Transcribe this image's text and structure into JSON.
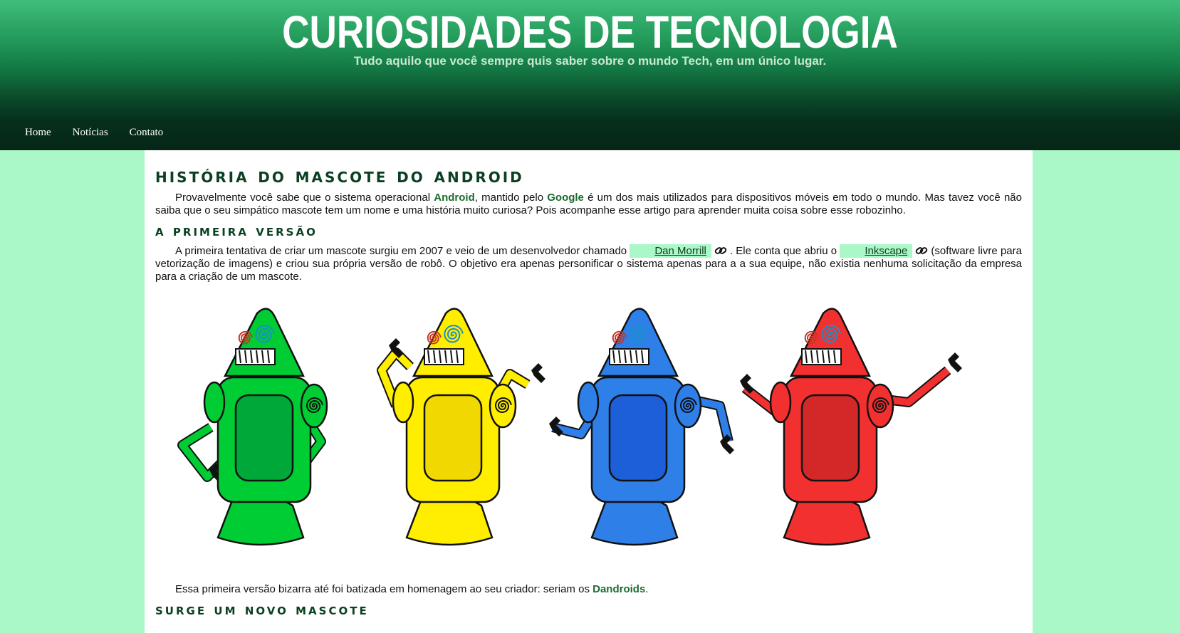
{
  "header": {
    "title": "CURIOSIDADES DE TECNOLOGIA",
    "subtitle": "Tudo aquilo que você sempre quis saber sobre o mundo Tech, em um único lugar."
  },
  "nav": [
    {
      "label": "Home"
    },
    {
      "label": "Notícias"
    },
    {
      "label": "Contato"
    }
  ],
  "article": {
    "title": "História do mascote do Android",
    "intro": {
      "t1": "Provavelmente você sabe que o sistema operacional ",
      "kw1": "Android",
      "t2": ", mantido pelo ",
      "kw2": "Google",
      "t3": " é um dos mais utilizados para dispositivos móveis em todo o mundo. Mas tavez você não saiba que o seu simpático mascote tem um nome e uma história muito curiosa? Pois acompanhe esse artigo para aprender muita coisa sobre esse robozinho."
    },
    "section1": {
      "title": "A primeira versão",
      "p1": {
        "t1": "A primeira tentativa de criar um mascote surgiu em 2007 e veio de um desenvolvedor chamado ",
        "link1": "Dan Morrill",
        "t2": ". Ele conta que abriu o ",
        "link2": "Inkscape",
        "t3": "(software livre para vetorização de imagens) e criou sua própria versão de robô. O objetivo era apenas personificar o sistema apenas para a a sua equipe, não existia nenhuma solicitação da empresa para a criação de um mascote."
      },
      "p2": {
        "t1": "Essa primeira versão bizarra até foi batizada em homenagem ao seu criador: seriam os ",
        "kw": "Dandroids",
        "t2": "."
      }
    },
    "section2": {
      "title": "Surge um novo mascote"
    }
  },
  "robots": {
    "items": [
      {
        "name": "green-robot",
        "color": "#00cc33",
        "dark": "#00a83a"
      },
      {
        "name": "yellow-robot",
        "color": "#ffee00",
        "dark": "#f0d800"
      },
      {
        "name": "blue-robot",
        "color": "#2f7fe8",
        "dark": "#1d5fd8"
      },
      {
        "name": "red-robot",
        "color": "#f23030",
        "dark": "#d22828"
      }
    ]
  },
  "colors": {
    "page_bg": "#aaf7c8",
    "keyword": "#1b6b2e",
    "chip_bg": "#aaf7c8"
  }
}
